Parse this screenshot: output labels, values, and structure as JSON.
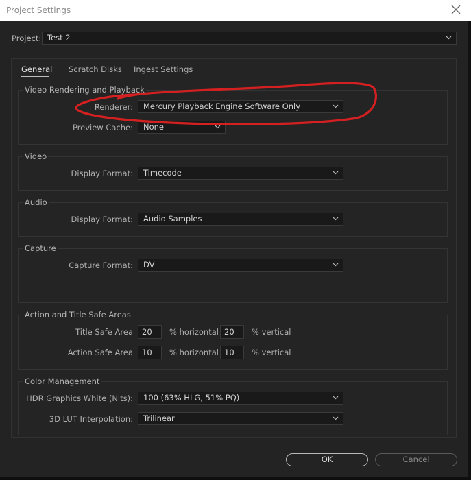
{
  "window": {
    "title": "Project Settings"
  },
  "project": {
    "label": "Project:",
    "value": "Test 2"
  },
  "tabs": [
    {
      "label": "General",
      "active": true
    },
    {
      "label": "Scratch Disks",
      "active": false
    },
    {
      "label": "Ingest Settings",
      "active": false
    }
  ],
  "video_rendering": {
    "title": "Video Rendering and Playback",
    "renderer_label": "Renderer:",
    "renderer_value": "Mercury Playback Engine Software Only",
    "preview_cache_label": "Preview Cache:",
    "preview_cache_value": "None"
  },
  "video": {
    "title": "Video",
    "display_format_label": "Display Format:",
    "display_format_value": "Timecode"
  },
  "audio": {
    "title": "Audio",
    "display_format_label": "Display Format:",
    "display_format_value": "Audio Samples"
  },
  "capture": {
    "title": "Capture",
    "capture_format_label": "Capture Format:",
    "capture_format_value": "DV"
  },
  "safe_areas": {
    "title": "Action and Title Safe Areas",
    "title_safe_label": "Title Safe Area",
    "title_safe_horizontal": "20",
    "title_safe_vertical": "20",
    "action_safe_label": "Action Safe Area",
    "action_safe_horizontal": "10",
    "action_safe_vertical": "10",
    "horizontal_unit": "% horizontal",
    "vertical_unit": "% vertical"
  },
  "color_management": {
    "title": "Color Management",
    "hdr_label": "HDR Graphics White (Nits):",
    "hdr_value": "100 (63% HLG, 51% PQ)",
    "lut_label": "3D LUT Interpolation:",
    "lut_value": "Trilinear"
  },
  "buttons": {
    "ok": "OK",
    "cancel": "Cancel"
  },
  "colors": {
    "annotation": "#d42020",
    "background": "#232323",
    "field": "#191919"
  }
}
